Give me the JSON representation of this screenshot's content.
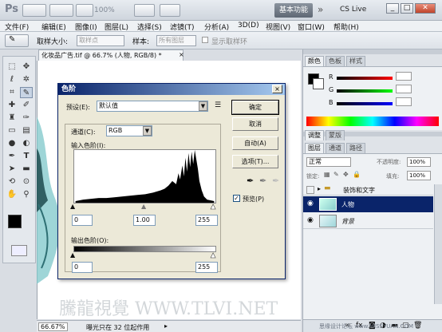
{
  "app": {
    "logo": "Ps",
    "zoom": "100%",
    "workspace_label": "基本功能",
    "chevrons": "»",
    "cs_live": "CS Live",
    "window_controls": [
      "_",
      "□",
      "✕"
    ]
  },
  "menu": [
    "文件(F)",
    "编辑(E)",
    "图像(I)",
    "图层(L)",
    "选择(S)",
    "滤镜(T)",
    "分析(A)",
    "3D(D)",
    "视图(V)",
    "窗口(W)",
    "帮助(H)"
  ],
  "options_bar": {
    "sample_size_label": "取样大小:",
    "sample_size_value": "取样点",
    "sample_label": "样本:",
    "sample_value": "所有图层",
    "show_ring_label": "显示取样环"
  },
  "document": {
    "tab_title": "化妆品广告.tif @ 66.7% (人物, RGB/8) *",
    "watermark": "騰龍視覺 WWW.TLVI.NET",
    "zoom_status": "66.67%",
    "status_text": "曝光只在 32 位起作用"
  },
  "levels_dialog": {
    "title": "色阶",
    "preset_label": "预设(E):",
    "preset_value": "默认值",
    "channel_label": "通道(C):",
    "channel_value": "RGB",
    "input_levels_label": "输入色阶(I):",
    "input_black": "0",
    "input_gamma": "1.00",
    "input_white": "255",
    "output_levels_label": "输出色阶(O):",
    "output_black": "0",
    "output_white": "255",
    "ok_label": "确定",
    "cancel_label": "取消",
    "auto_label": "自动(A)",
    "options_label": "选项(T)...",
    "preview_label": "预览(P)",
    "preview_checked": true
  },
  "color_panel": {
    "tabs": [
      "颜色",
      "色板",
      "样式"
    ],
    "channels": [
      {
        "name": "R",
        "value": "",
        "color": "#e02020"
      },
      {
        "name": "G",
        "value": "",
        "color": "#20a020"
      },
      {
        "name": "B",
        "value": "",
        "color": "#2040e0"
      }
    ]
  },
  "adjust_panel": {
    "tabs": [
      "调整",
      "蒙版"
    ]
  },
  "layers_panel": {
    "tabs": [
      "图层",
      "通道",
      "路径"
    ],
    "blend_mode": "正常",
    "opacity_label": "不透明度:",
    "opacity_value": "100%",
    "lock_label": "锁定:",
    "fill_label": "填充:",
    "fill_value": "100%",
    "layers": [
      {
        "name": "装饰和文字",
        "type": "group",
        "selected": false
      },
      {
        "name": "人物",
        "type": "layer",
        "selected": true
      },
      {
        "name": "背景",
        "type": "background",
        "selected": false
      }
    ]
  },
  "footer_watermark": "思缘设计论坛 www.MISSYUAN.COM"
}
